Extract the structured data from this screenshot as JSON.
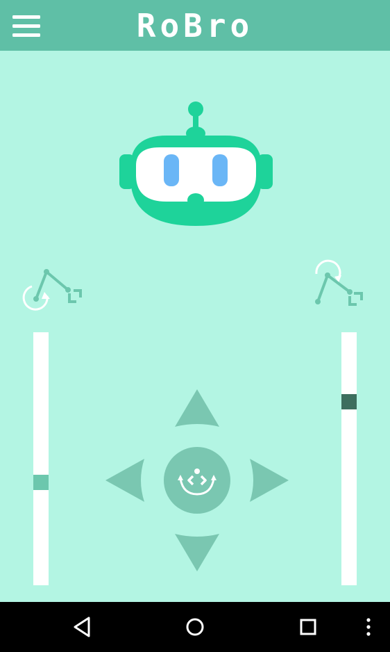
{
  "app": {
    "title": "RoBro"
  },
  "colors": {
    "header": "#5fbfa6",
    "background": "#b3f5e3",
    "accent": "#7ac7b1",
    "robot": "#1ed39a",
    "robot_eyes": "#6ab6f6",
    "left_slider_thumb": "#6cc7ad",
    "right_slider_thumb": "#3d6e5e",
    "nav_bar": "#000000"
  },
  "header": {
    "menu_icon": "hamburger-menu-icon"
  },
  "robot_logo": {
    "icon": "robot-head-icon"
  },
  "left_arm": {
    "icon": "robotic-arm-rotate-base-icon",
    "slider_level": 0.6
  },
  "right_arm": {
    "icon": "robotic-arm-rotate-joint-icon",
    "slider_level": 0.26
  },
  "dpad": {
    "up_icon": "arrow-up-icon",
    "down_icon": "arrow-down-icon",
    "left_icon": "arrow-left-icon",
    "right_icon": "arrow-right-icon",
    "center_icon": "rotate-code-icon"
  },
  "system_nav": {
    "back_icon": "triangle-back-icon",
    "home_icon": "circle-home-icon",
    "recents_icon": "square-recents-icon",
    "more_icon": "vertical-dots-icon"
  }
}
